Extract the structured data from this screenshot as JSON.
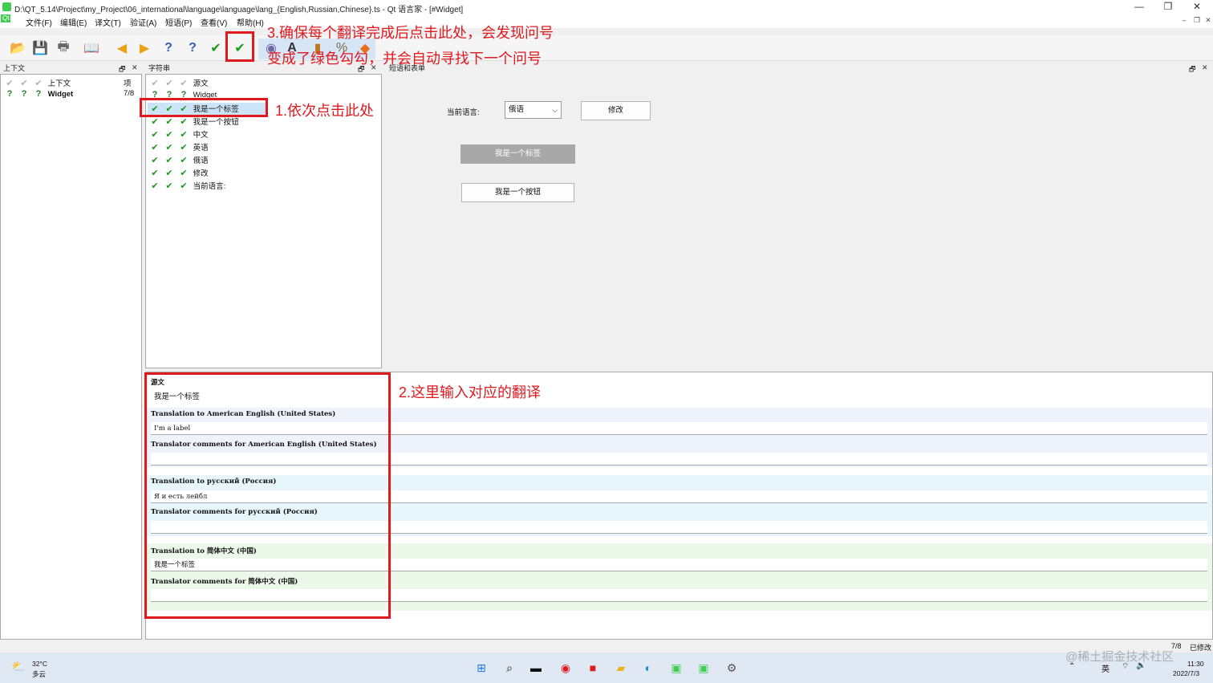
{
  "window": {
    "title": "D:\\QT_5.14\\Project\\my_Project\\06_international\\language\\language\\lang_{English,Russian,Chinese}.ts - Qt 语言家 - [#Widget]",
    "minimize": "—",
    "maximize": "❐",
    "close": "✕",
    "app_badge": "Qt"
  },
  "menu": [
    "文件(F)",
    "编辑(E)",
    "译文(T)",
    "验证(A)",
    "短语(P)",
    "查看(V)",
    "帮助(H)"
  ],
  "mdi_controls": [
    "–",
    "❐",
    "✕"
  ],
  "toolbar_icons": [
    "open-folder-icon",
    "save-icon",
    "print-icon",
    "phrase-book-icon",
    "prev-arrow-icon",
    "next-arrow-icon",
    "prev-unfinished-icon",
    "next-unfinished-icon",
    "accept-check-icon",
    "accept-next-icon",
    "accelerator-check-icon",
    "ending-punct-icon",
    "phrase-match-icon",
    "placemarker-icon",
    "surrounding-ws-icon"
  ],
  "context_panel": {
    "title": "上下文",
    "columns": {
      "name": "上下文",
      "items": "项"
    },
    "rows": [
      {
        "name": "Widget",
        "items": "7/8"
      }
    ]
  },
  "strings_panel": {
    "title": "字符串",
    "header": "源文",
    "rows": [
      {
        "text": "Widget",
        "status": "unfinished"
      },
      {
        "text": "我是一个标签",
        "status": "done"
      },
      {
        "text": "我是一个按钮",
        "status": "done"
      },
      {
        "text": "中文",
        "status": "done"
      },
      {
        "text": "英语",
        "status": "done"
      },
      {
        "text": "俄语",
        "status": "done"
      },
      {
        "text": "修改",
        "status": "done"
      },
      {
        "text": "当前语言:",
        "status": "done"
      }
    ]
  },
  "form_panel": {
    "title": "短语和表单",
    "current_language_label": "当前语言:",
    "combo_value": "俄语",
    "modify_button": "修改",
    "label_preview": "我是一个标签",
    "button_preview": "我是一个按钮"
  },
  "editor": {
    "source_title": "源文",
    "source_text": "我是一个标签",
    "sections": [
      {
        "trans_title": "Translation to American English (United States)",
        "trans_value": "I'm a label",
        "comment_title": "Translator comments for American English (United States)",
        "comment_value": "",
        "color": "#eef3fb"
      },
      {
        "trans_title": "Translation to русский (Россия)",
        "trans_value": "Я и есть лейбл",
        "comment_title": "Translator comments for русский (Россия)",
        "comment_value": "",
        "color": "#e6f6fb"
      },
      {
        "trans_title": "Translation to 简体中文 (中国)",
        "trans_value": "我是一个标签",
        "comment_title": "Translator comments for 简体中文 (中国)",
        "comment_value": "",
        "color": "#ecf8ea"
      }
    ]
  },
  "annotations": {
    "a1": "1.依次点击此处",
    "a2": "2.这里输入对应的翻译",
    "a3_line1": "3.确保每个翻译完成后点击此处，会发现问号",
    "a3_line2": "变成了绿色勾勾，并会自动寻找下一个问号"
  },
  "statusbar": {
    "count": "7/8",
    "state": "已修改"
  },
  "taskbar": {
    "temp": "32°C",
    "weather": "多云",
    "time": "11:30",
    "date": "2022/7/3",
    "ime": "英",
    "watermark": "@稀土掘金技术社区"
  },
  "colors": {
    "accent_red": "#e0191f",
    "check_green": "#1a9a1a",
    "highlight": "#cce4f7"
  }
}
